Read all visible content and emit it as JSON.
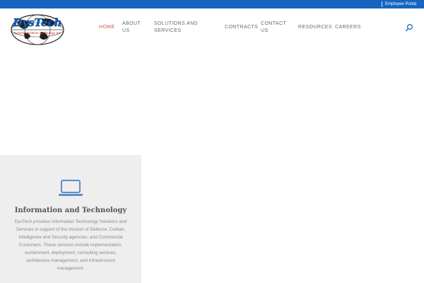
{
  "topbar": {
    "color": "#1565c0",
    "portal_label": "Employee Portal"
  },
  "logo": {
    "text": "DysTech",
    "tagline": "Dynamic Systems Technology, Inc."
  },
  "nav": {
    "items": [
      {
        "label": "HOME",
        "active": true
      },
      {
        "label": "ABOUT",
        "label2": "US"
      },
      {
        "label": "SOLUTIONS AND",
        "label2": "SERVICES"
      },
      {
        "label": "CONTRACTS"
      },
      {
        "label": "CONTACT",
        "label2": "US"
      },
      {
        "label": "RESOURCES"
      },
      {
        "label": "CAREERS"
      }
    ],
    "active_color": "#d9534f",
    "search_icon": "search-icon"
  },
  "card": {
    "icon": "laptop-icon",
    "icon_color": "#5b8fc7",
    "title": "Information and Technology",
    "body": "DysTech provides Information Technology Solutions and Services in support of the mission of Defense, Civilian, Intelligence and Security agencies, and Commercial Customers. These services include implementation, sustainment, deployment, consulting services, architecture management, and infrastructure management."
  }
}
